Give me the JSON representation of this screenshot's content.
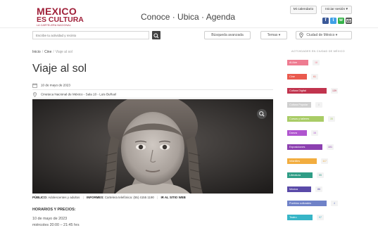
{
  "header": {
    "logo_main": "MEXICO",
    "logo_sub": "ES CULTURA",
    "logo_tag": "LA CARTELERA NACIONAL",
    "tagline": "Conoce · Ubica · Agenda",
    "calendar_btn": "Mi calendario",
    "login_btn": "Iniciar sesión ▾"
  },
  "search": {
    "placeholder": "Escribe tu actividad y recinto",
    "advanced": "Búsqueda avanzada",
    "themes": "Temas ▾",
    "city": "Ciudad de México ▾"
  },
  "breadcrumb": [
    "Inicio",
    "Cine",
    "Viaje al sol"
  ],
  "event": {
    "title": "Viaje al sol",
    "date": "10 de mayo de 2023",
    "venue": "Cineteca Nacional de México - Sala 10 - Luis Buñuel"
  },
  "info_bar": {
    "public_label": "PÚBLICO:",
    "public_value": "Adolescentes y adultos",
    "info_label": "INFORMES:",
    "info_value": "Cartelera telefónica: (55) 4155 1190",
    "site_link": "IR AL SITIO WEB"
  },
  "hours": {
    "title": "HORARIOS Y PRECIOS:",
    "lines": [
      "10 de mayo de 2023",
      "miércoles 20:00 – 21:45 hrs"
    ]
  },
  "sidebar": {
    "title": "ACTIVIDADES EN CIUDAD DE MÉXICO",
    "categories": [
      {
        "label": "Al Aire",
        "count": "18",
        "color": "#ee7c91"
      },
      {
        "label": "Cine",
        "count": "61",
        "color": "#ea5a4e"
      },
      {
        "label": "Cultura Digital",
        "count": "139",
        "color": "#c1344e"
      },
      {
        "label": "Cultura Popular",
        "count": "8",
        "color": "#cfcfcf"
      },
      {
        "label": "Cursos y talleres",
        "count": "35",
        "color": "#a9cc66"
      },
      {
        "label": "Danza",
        "count": "16",
        "color": "#b055cf"
      },
      {
        "label": "Exposiciones",
        "count": "101",
        "color": "#8c40b0"
      },
      {
        "label": "Infantiles",
        "count": "117",
        "color": "#f2ad3f"
      },
      {
        "label": "Literatura",
        "count": "55",
        "color": "#2f9d86"
      },
      {
        "label": "Música",
        "count": "86",
        "color": "#5a4aa8"
      },
      {
        "label": "Pueblos culturales",
        "count": "4",
        "color": "#6f82c8"
      },
      {
        "label": "Teatro",
        "count": "97",
        "color": "#37b5c7"
      },
      {
        "label": "",
        "count": "",
        "color": "#8fd0dc"
      }
    ]
  },
  "colors": {
    "brand": "#a0213a",
    "facebook": "#3b5998",
    "twitter": "#3fa0e6",
    "whatsapp": "#36b24a",
    "mail": "#555555"
  }
}
